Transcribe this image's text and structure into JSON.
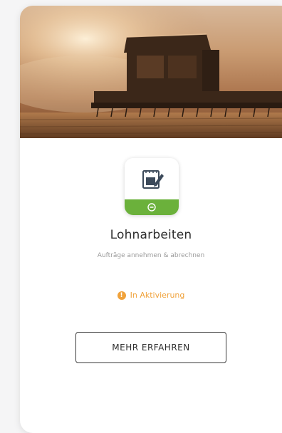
{
  "card": {
    "image": {
      "subject": "combine harvester in wheat field at sunset"
    },
    "app_icon": {
      "name": "notepad-pencil-icon",
      "accent_color": "#6bb13b"
    },
    "title": "Lohnarbeiten",
    "subtitle": "Aufträge annehmen & abrechnen",
    "status": {
      "text": "In Aktivierung",
      "icon": "info-icon",
      "color": "#f0a23b"
    },
    "cta_label": "MEHR ERFAHREN"
  }
}
